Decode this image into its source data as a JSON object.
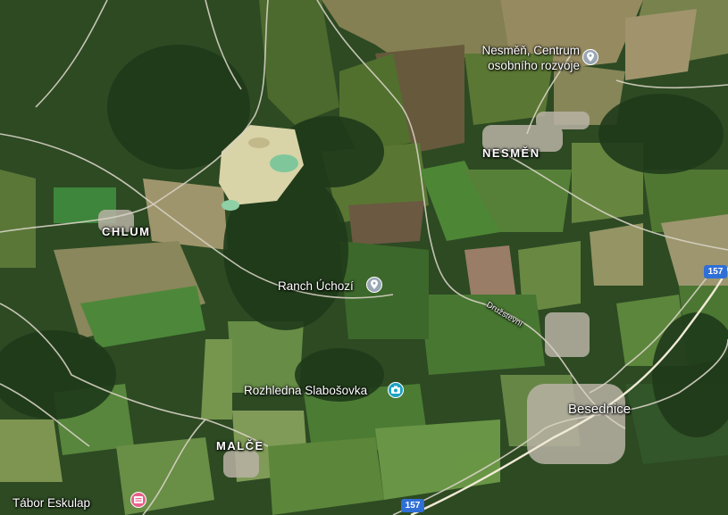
{
  "colors": {
    "road_shield": "#2f6fd6",
    "poi_pin": "#9aa7b5",
    "camp_pin": "#e8608a",
    "viewpoint_pin": "#1fa2c4",
    "label_text": "#ffffff"
  },
  "places": {
    "chlum": "CHLUM",
    "nesmen": "NESMĚN",
    "malce": "MALČE",
    "besednice": "Besednice"
  },
  "pois": {
    "centrum_line1": "Nesměň, Centrum",
    "centrum_line2": "osobního rozvoje",
    "centrum_icon": "map-pin-icon",
    "ranch": "Ranch Úchozí",
    "ranch_icon": "map-pin-icon",
    "rozhledna": "Rozhledna Slabošovka",
    "rozhledna_icon": "camera-pin-icon",
    "tabor": "Tábor Eskulap",
    "tabor_icon": "camp-pin-icon"
  },
  "streets": {
    "druzstevni": "Družstevní"
  },
  "roads": {
    "route_157_east": "157",
    "route_157_south": "157"
  }
}
